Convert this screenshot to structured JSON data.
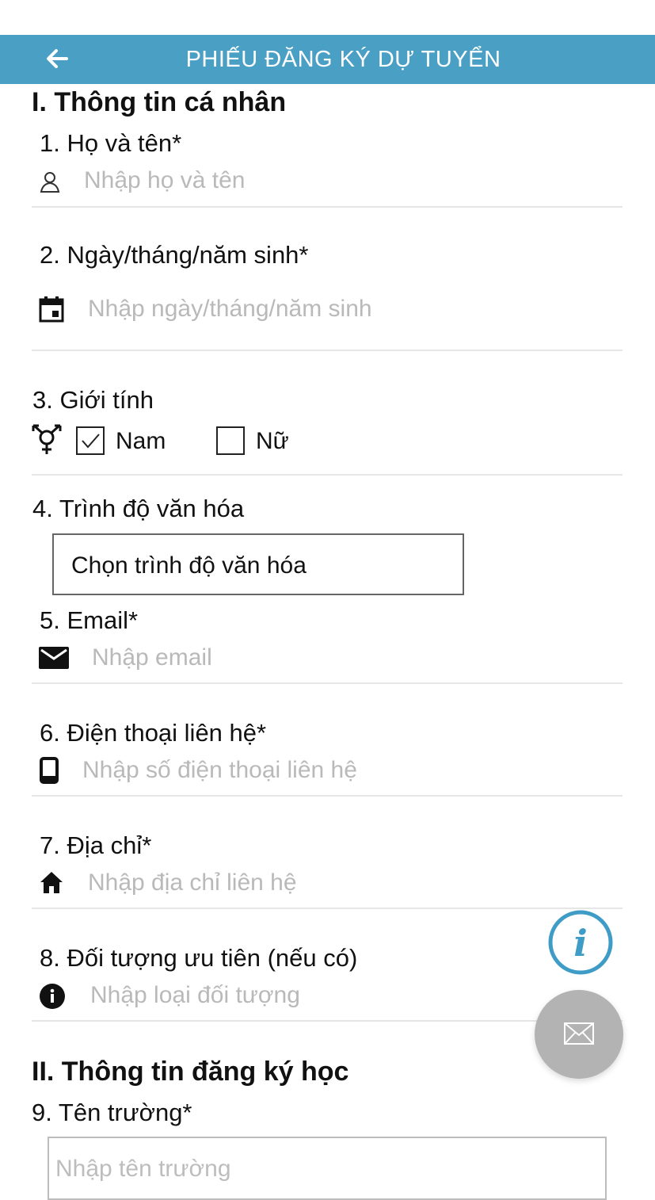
{
  "header": {
    "title": "PHIẾU ĐĂNG KÝ DỰ TUYỂN"
  },
  "section1": {
    "title": "I. Thông tin cá nhân"
  },
  "fields": {
    "name": {
      "label": "1. Họ và tên*",
      "placeholder": "Nhập họ và tên"
    },
    "dob": {
      "label": "2. Ngày/tháng/năm sinh*",
      "placeholder": "Nhập ngày/tháng/năm sinh"
    },
    "gender": {
      "label": "3. Giới tính",
      "male": "Nam",
      "female": "Nữ",
      "selected": "Nam"
    },
    "education": {
      "label": "4. Trình độ văn hóa",
      "value": "Chọn trình độ văn hóa"
    },
    "email": {
      "label": "5. Email*",
      "placeholder": "Nhập email"
    },
    "phone": {
      "label": "6. Điện thoại liên hệ*",
      "placeholder": "Nhập số điện thoại liên hệ"
    },
    "address": {
      "label": "7. Địa chỉ*",
      "placeholder": "Nhập địa chỉ liên hệ"
    },
    "priority": {
      "label": "8. Đối tượng ưu tiên (nếu có)",
      "placeholder": "Nhập loại đối tượng"
    }
  },
  "section2": {
    "title": "II. Thông tin đăng ký học"
  },
  "school": {
    "label": "9. Tên trường*",
    "placeholder": "Nhập tên trường"
  },
  "colors": {
    "header": "#4a9fc5",
    "placeholder": "#b9b9b9",
    "info_accent": "#3e9cc6",
    "fab": "#b3b3b3"
  }
}
